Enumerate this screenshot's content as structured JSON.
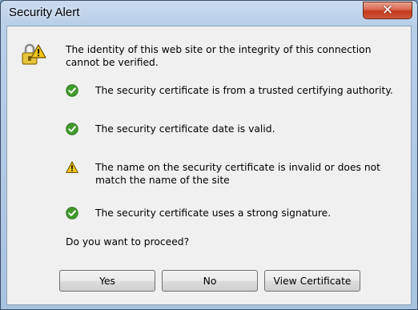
{
  "window": {
    "title": "Security Alert",
    "close_symbol": "✕"
  },
  "message": "The identity of this web site or the integrity of this connection cannot be verified.",
  "checks": [
    {
      "icon": "check-icon",
      "text": "The security certificate is from a trusted certifying authority."
    },
    {
      "icon": "check-icon",
      "text": "The security certificate date is valid."
    },
    {
      "icon": "warning-icon",
      "text": "The name on the security certificate is invalid or does not match the name of the site"
    },
    {
      "icon": "check-icon",
      "text": "The security certificate uses a strong signature."
    }
  ],
  "question": "Do you want to proceed?",
  "buttons": {
    "yes": "Yes",
    "no": "No",
    "view_certificate": "View Certificate"
  },
  "colors": {
    "check_green": "#3f9b2a",
    "warning_yellow": "#f4c51a",
    "close_red": "#c4391d"
  }
}
